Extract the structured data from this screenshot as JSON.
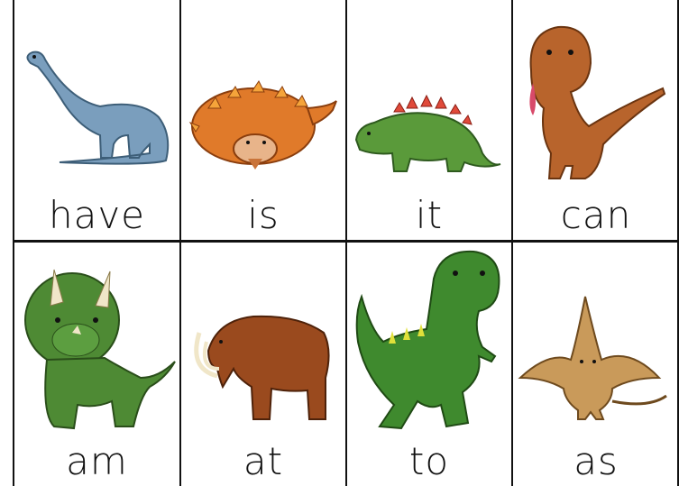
{
  "cards": [
    {
      "word": "have",
      "picture": "blue-brachiosaurus",
      "color": "#7a9ebd"
    },
    {
      "word": "is",
      "picture": "orange-ankylosaurus",
      "color": "#e07a2a"
    },
    {
      "word": "it",
      "picture": "green-stegosaurus",
      "color": "#5a9a3a"
    },
    {
      "word": "can",
      "picture": "brown-t-rex",
      "color": "#b8642c"
    },
    {
      "word": "am",
      "picture": "green-triceratops",
      "color": "#4e8a34"
    },
    {
      "word": "at",
      "picture": "brown-mammoth",
      "color": "#9a4a1e"
    },
    {
      "word": "to",
      "picture": "green-t-rex",
      "color": "#3f8a2e"
    },
    {
      "word": "as",
      "picture": "tan-pterodactyl",
      "color": "#b98a4a"
    }
  ]
}
